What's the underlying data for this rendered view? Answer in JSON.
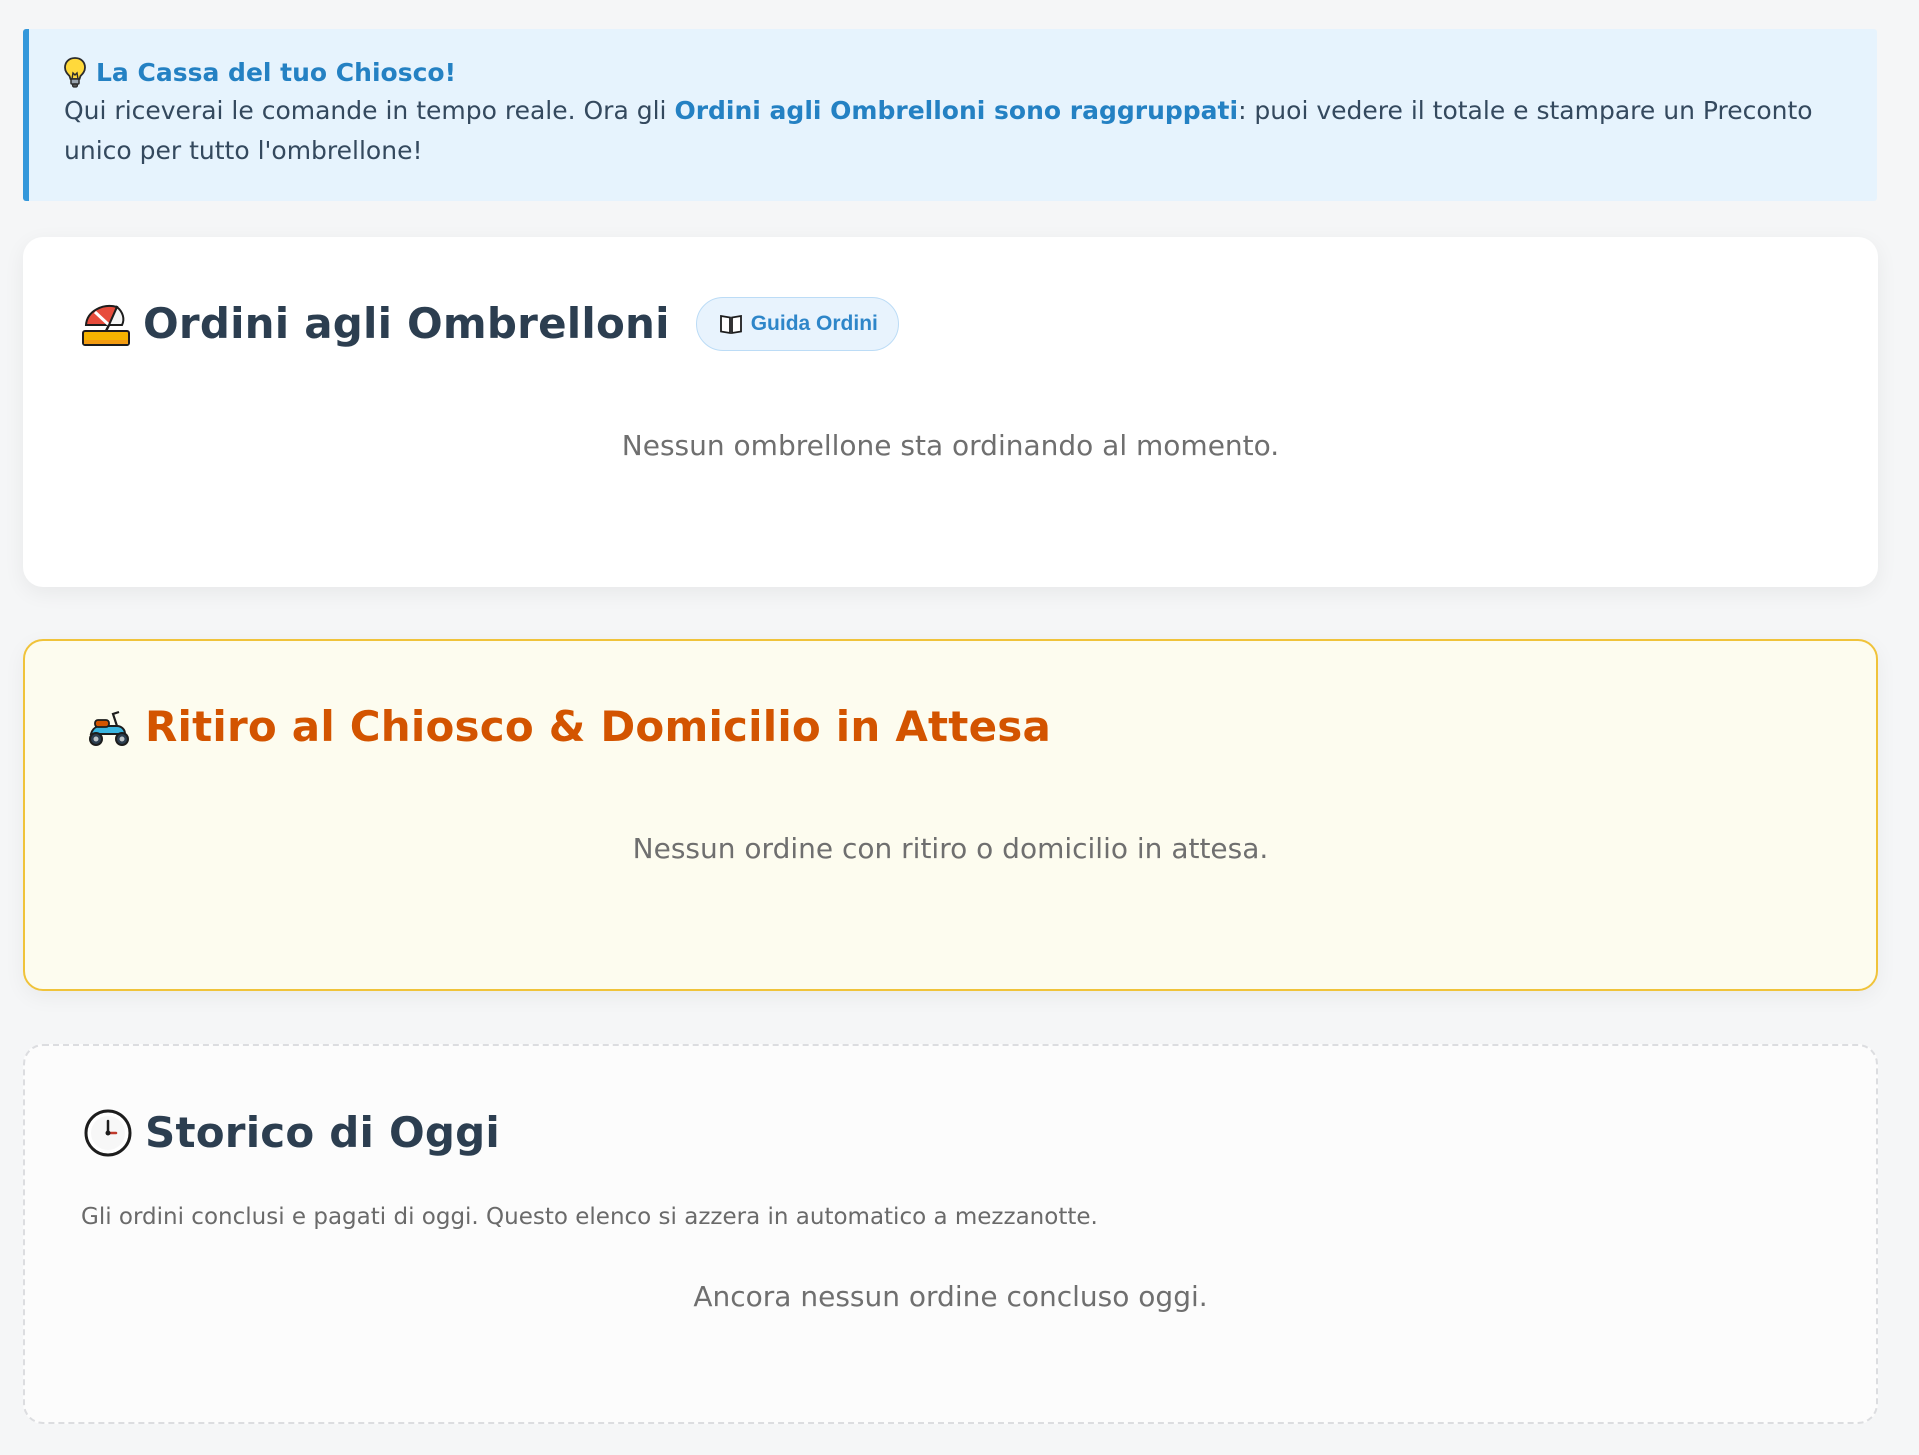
{
  "info_banner": {
    "title": "La Cassa del tuo Chiosco!",
    "text_before": "Qui riceverai le comande in tempo reale. Ora gli ",
    "text_highlight": "Ordini agli Ombrelloni sono raggruppati",
    "text_after": ": puoi vedere il totale e stampare un Preconto unico per tutto l'ombrellone!",
    "icon": "lightbulb-icon",
    "accent_color": "#3498db"
  },
  "ombrelloni": {
    "title": "Ordini agli Ombrelloni",
    "icon": "umbrella-on-ground-icon",
    "guide_button_label": "Guida Ordini",
    "guide_button_icon": "open-book-icon",
    "empty_message": "Nessun ombrellone sta ordinando al momento."
  },
  "ritiro": {
    "title": "Ritiro al Chiosco & Domicilio in Attesa",
    "icon": "scooter-icon",
    "empty_message": "Nessun ordine con ritiro o domicilio in attesa.",
    "accent_color": "#d35400",
    "border_color": "#f0c33a"
  },
  "storico": {
    "title": "Storico di Oggi",
    "icon": "clock-icon",
    "description": "Gli ordini conclusi e pagati di oggi. Questo elenco si azzera in automatico a mezzanotte.",
    "empty_message": "Ancora nessun ordine concluso oggi."
  }
}
